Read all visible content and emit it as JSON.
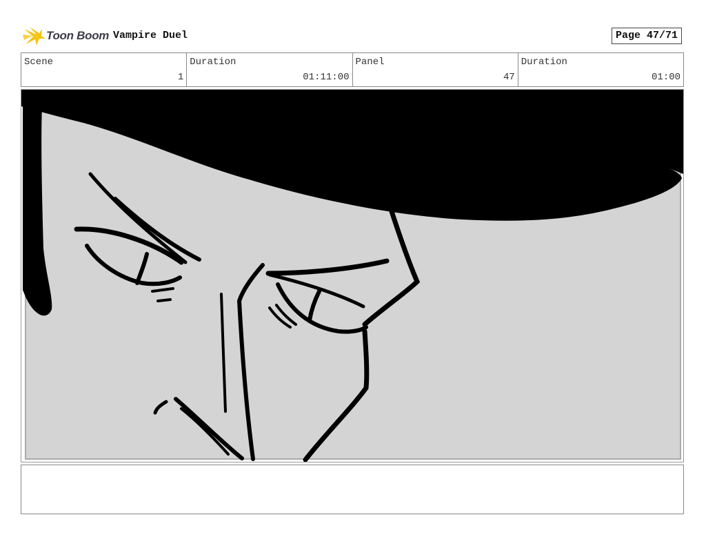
{
  "header": {
    "logo_text": "Toon Boom",
    "project_title": "Vampire Duel",
    "page_label": "Page 47/71"
  },
  "info": [
    {
      "label": "Scene",
      "value": "1"
    },
    {
      "label": "Duration",
      "value": "01:11:00"
    },
    {
      "label": "Panel",
      "value": "47"
    },
    {
      "label": "Duration",
      "value": "01:00"
    }
  ],
  "panel": {
    "background_color": "#d4d4d4",
    "ink_color": "#000000",
    "icon": "sketch-face-hat-drawing"
  },
  "notes": {
    "text": ""
  },
  "colors": {
    "logo_star": "#f5c518",
    "logo_text": "#3d3d4a",
    "border": "#888888"
  }
}
